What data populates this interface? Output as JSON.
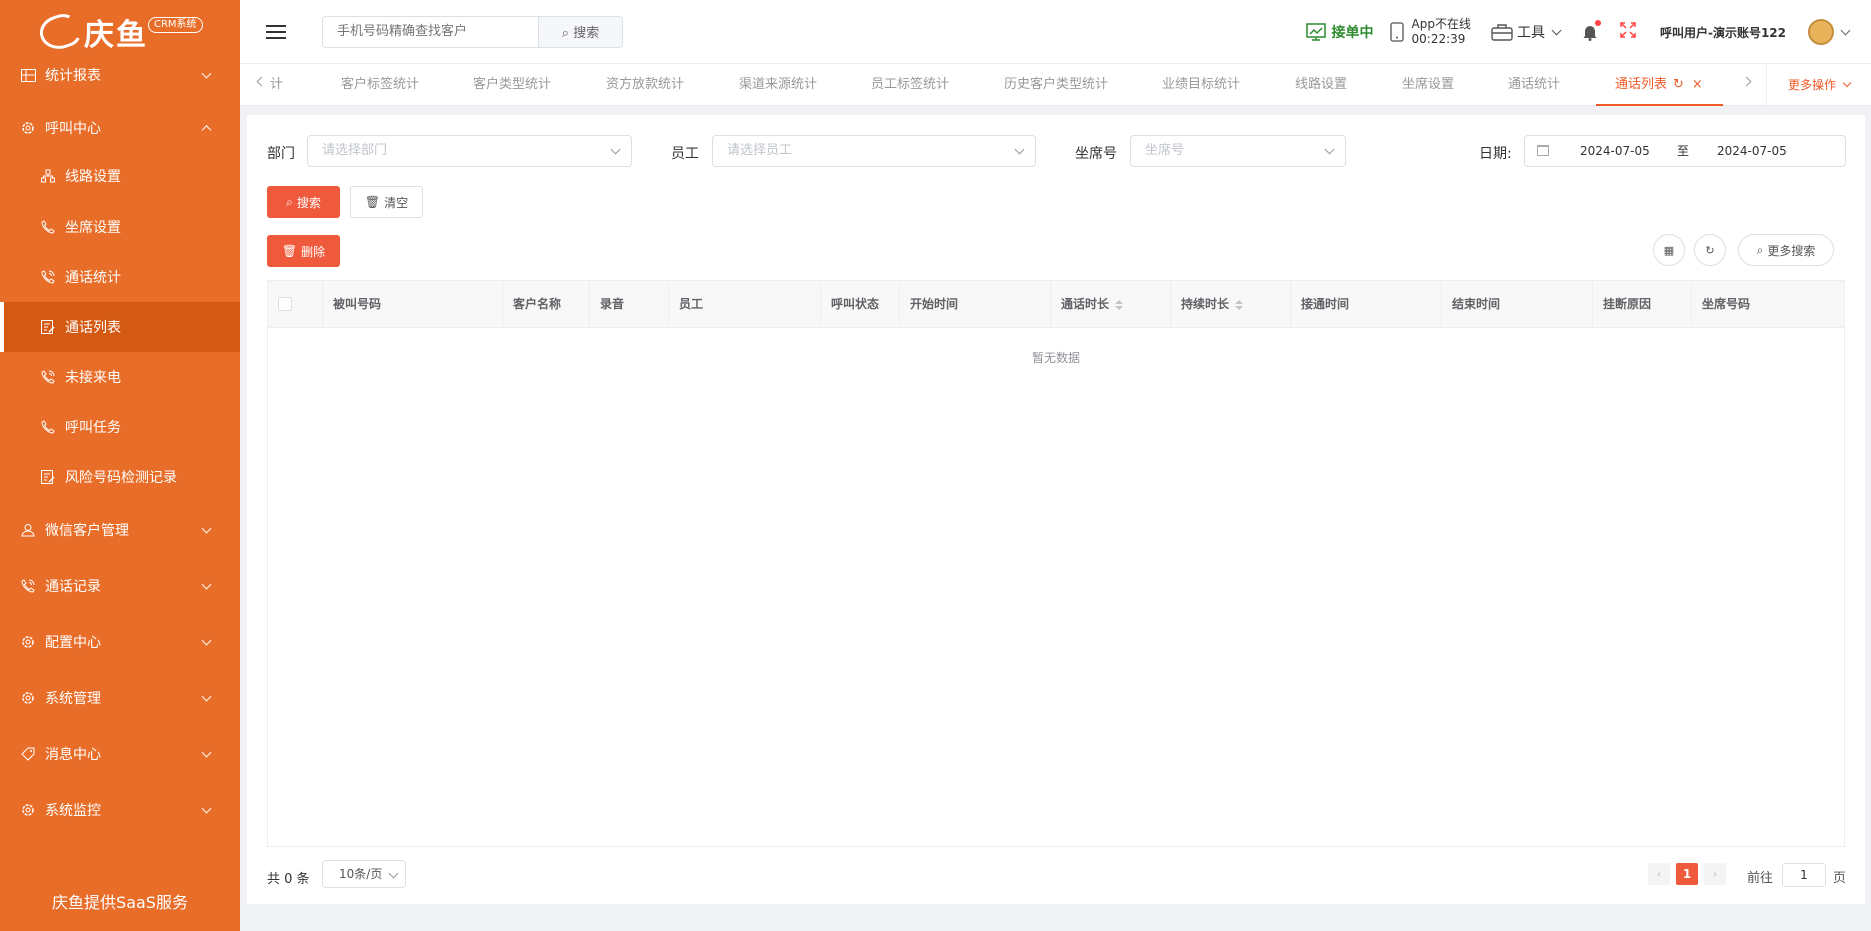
{
  "app": {
    "logo_text": "庆鱼",
    "badge": "CRM系统",
    "footer": "庆鱼提供SaaS服务"
  },
  "sidebar": {
    "items": [
      {
        "label": "统计报表",
        "icon": "chart-icon",
        "expanded": false
      },
      {
        "label": "呼叫中心",
        "icon": "gear-icon",
        "expanded": true
      },
      {
        "label": "线路设置",
        "icon": "network-icon",
        "sub": true
      },
      {
        "label": "坐席设置",
        "icon": "phone-icon",
        "sub": true
      },
      {
        "label": "通话统计",
        "icon": "phone-call-icon",
        "sub": true
      },
      {
        "label": "通话列表",
        "icon": "list-edit-icon",
        "sub": true,
        "active": true
      },
      {
        "label": "未接来电",
        "icon": "phone-call-icon",
        "sub": true
      },
      {
        "label": "呼叫任务",
        "icon": "phone-icon",
        "sub": true
      },
      {
        "label": "风险号码检测记录",
        "icon": "list-edit-icon",
        "sub": true
      },
      {
        "label": "微信客户管理",
        "icon": "user-icon",
        "expanded": false
      },
      {
        "label": "通话记录",
        "icon": "phone-call-icon",
        "expanded": false
      },
      {
        "label": "配置中心",
        "icon": "gear-icon",
        "expanded": false
      },
      {
        "label": "系统管理",
        "icon": "gear-icon",
        "expanded": false
      },
      {
        "label": "消息中心",
        "icon": "tag-icon",
        "expanded": false
      },
      {
        "label": "系统监控",
        "icon": "gear-icon",
        "expanded": false
      }
    ]
  },
  "header": {
    "search_placeholder": "手机号码精确查找客户",
    "search_button": "搜索",
    "status": "接单中",
    "app_status": "App不在线",
    "app_time": "00:22:39",
    "tools": "工具",
    "user": "呼叫用户-演示账号122"
  },
  "tabs": {
    "items": [
      "计",
      "客户标签统计",
      "客户类型统计",
      "资方放款统计",
      "渠道来源统计",
      "员工标签统计",
      "历史客户类型统计",
      "业绩目标统计",
      "线路设置",
      "坐席设置",
      "通话统计",
      "通话列表"
    ],
    "active": "通话列表",
    "more": "更多操作"
  },
  "filters": {
    "dept_label": "部门",
    "dept_placeholder": "请选择部门",
    "staff_label": "员工",
    "staff_placeholder": "请选择员工",
    "seat_label": "坐席号",
    "seat_placeholder": "坐席号",
    "date_label": "日期:",
    "date_start": "2024-07-05",
    "date_sep": "至",
    "date_end": "2024-07-05"
  },
  "actions": {
    "search": "搜索",
    "clear": "清空",
    "delete": "删除",
    "more_search": "更多搜索"
  },
  "table": {
    "columns": [
      "被叫号码",
      "客户名称",
      "录音",
      "员工",
      "呼叫状态",
      "开始时间",
      "通话时长",
      "持续时长",
      "接通时间",
      "结束时间",
      "挂断原因",
      "坐席号码"
    ],
    "sortable": [
      "通话时长",
      "持续时长"
    ],
    "empty": "暂无数据"
  },
  "pagination": {
    "total": "共 0 条",
    "page_size": "10条/页",
    "current": "1",
    "goto": "前往",
    "goto_value": "1",
    "page_unit": "页"
  }
}
